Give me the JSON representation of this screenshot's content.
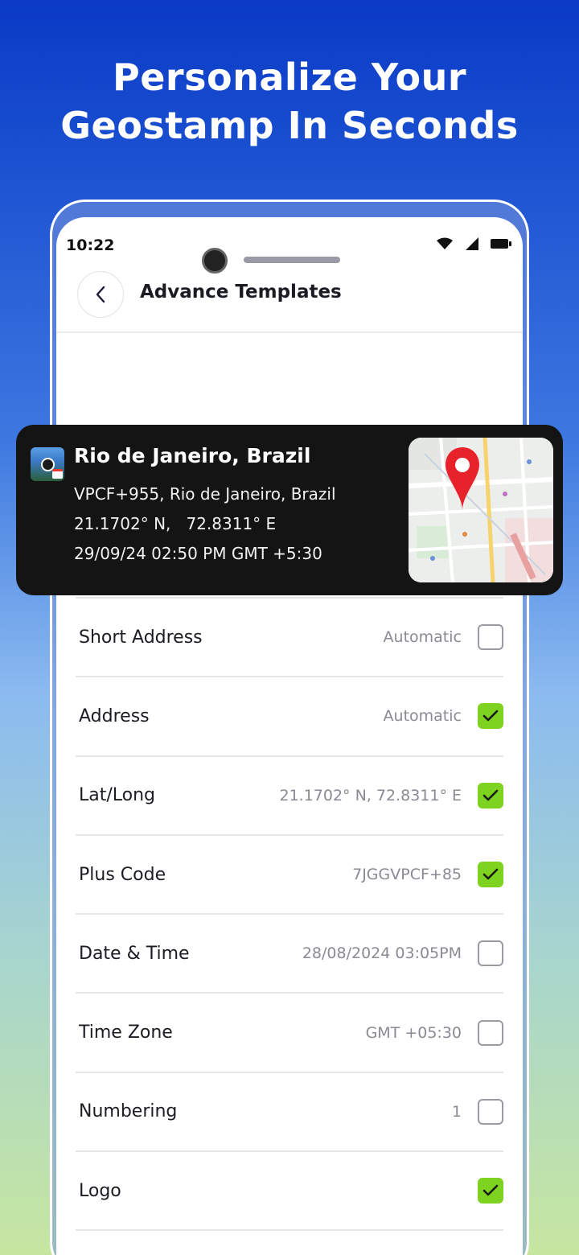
{
  "promo": {
    "headline_line1": "Personalize Your",
    "headline_line2": "Geostamp In Seconds"
  },
  "status_bar": {
    "time": "10:22",
    "icons": [
      "wifi-icon",
      "signal-icon",
      "battery-icon"
    ]
  },
  "header": {
    "back_icon": "chevron-left-icon",
    "title": "Advance Templates"
  },
  "stamp": {
    "city": "Rio de Janeiro, Brazil",
    "address": "VPCF+955, Rio de Janeiro, Brazil",
    "lat": "21.1702° N,",
    "long": "72.8311° E",
    "datetime": "29/09/24 02:50 PM GMT +5:30",
    "map_pin_icon": "map-pin-icon"
  },
  "settings": [
    {
      "label": "Short Address",
      "value": "Automatic",
      "checked": false
    },
    {
      "label": "Address",
      "value": "Automatic",
      "checked": true
    },
    {
      "label": "Lat/Long",
      "value": "21.1702° N, 72.8311° E",
      "checked": true
    },
    {
      "label": "Plus Code",
      "value": "7JGGVPCF+85",
      "checked": true
    },
    {
      "label": "Date & Time",
      "value": "28/08/2024 03:05PM",
      "checked": false
    },
    {
      "label": "Time Zone",
      "value": "GMT +05:30",
      "checked": false
    },
    {
      "label": "Numbering",
      "value": "1",
      "checked": false
    },
    {
      "label": "Logo",
      "value": "",
      "checked": true
    }
  ],
  "colors": {
    "accent_check": "#7ed321",
    "stamp_bg": "#141414",
    "pin_red": "#e8222a"
  }
}
